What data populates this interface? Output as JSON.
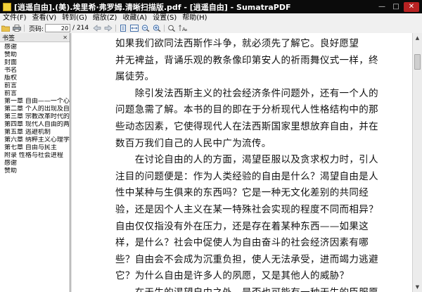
{
  "window": {
    "title": "[逍遥自由].(美).埃里希·弗罗姆.清晰扫描版.pdf - [逍遥自由] - SumatraPDF",
    "min_glyph": "—",
    "max_glyph": "□",
    "close_glyph": "✕"
  },
  "menu": [
    "文件(F)",
    "查看(V)",
    "转到(G)",
    "缩放(Z)",
    "收藏(A)",
    "设置(S)",
    "帮助(H)"
  ],
  "toolbar": {
    "page_label": "页码:",
    "current_page": "20",
    "total_pages": "/ 214"
  },
  "sidebar": {
    "title": "书签",
    "close_glyph": "✕",
    "items": [
      "感谢",
      "赞助",
      "封面",
      "书名",
      "版权",
      "前言",
      "前言",
      "第一章 自由——一个心理",
      "第二章 个人的出现及自由",
      "第三章 宗教改革时代的自",
      "第四章 现代人自由的两重",
      "第五章 逃避机制",
      "第六章 纳粹主义心理学",
      "第七章 自由与民主",
      "附录 性格与社会进程",
      "感谢",
      "赞助"
    ]
  },
  "document": {
    "lines": [
      "如果我们欲同法西斯作斗争，就必须先了解它。良好愿望",
      "并无裨益，背诵乐观的教条像印第安人的祈雨舞仪式一样，终",
      "属徒劳。",
      "　　除引发法西斯主义的社会经济条件问题外，还有一个人的",
      "问题急需了解。本书的目的即在于分析现代人性格结构中的那",
      "些动态因素，它使得现代人在法西斯国家里想放弃自由，并在",
      "数百万我们自己的人民中广为流传。",
      "　　在讨论自由的人的方面，渴望臣服以及贪求权力时，引人",
      "注目的问题便是：作为人类经验的自由是什么？渴望自由是人",
      "性中某种与生俱来的东西吗？它是一种无文化差别的共同经",
      "验，还是因个人主义在某一特殊社会实现的程度不同而相异？",
      "自由仅仅指没有外在压力，还是存在着某种东西——如果这",
      "样，是什么？社会中促使人为自由奋斗的社会经济因素有哪",
      "些？自由会不会成为沉重负担，使人无法承受，进而竭力逃避",
      "它？为什么自由是许多人的夙愿，又是其他人的威胁？",
      "　　在天生的渴望自由之外，是否也可能有一种天生的臣服愿"
    ]
  }
}
